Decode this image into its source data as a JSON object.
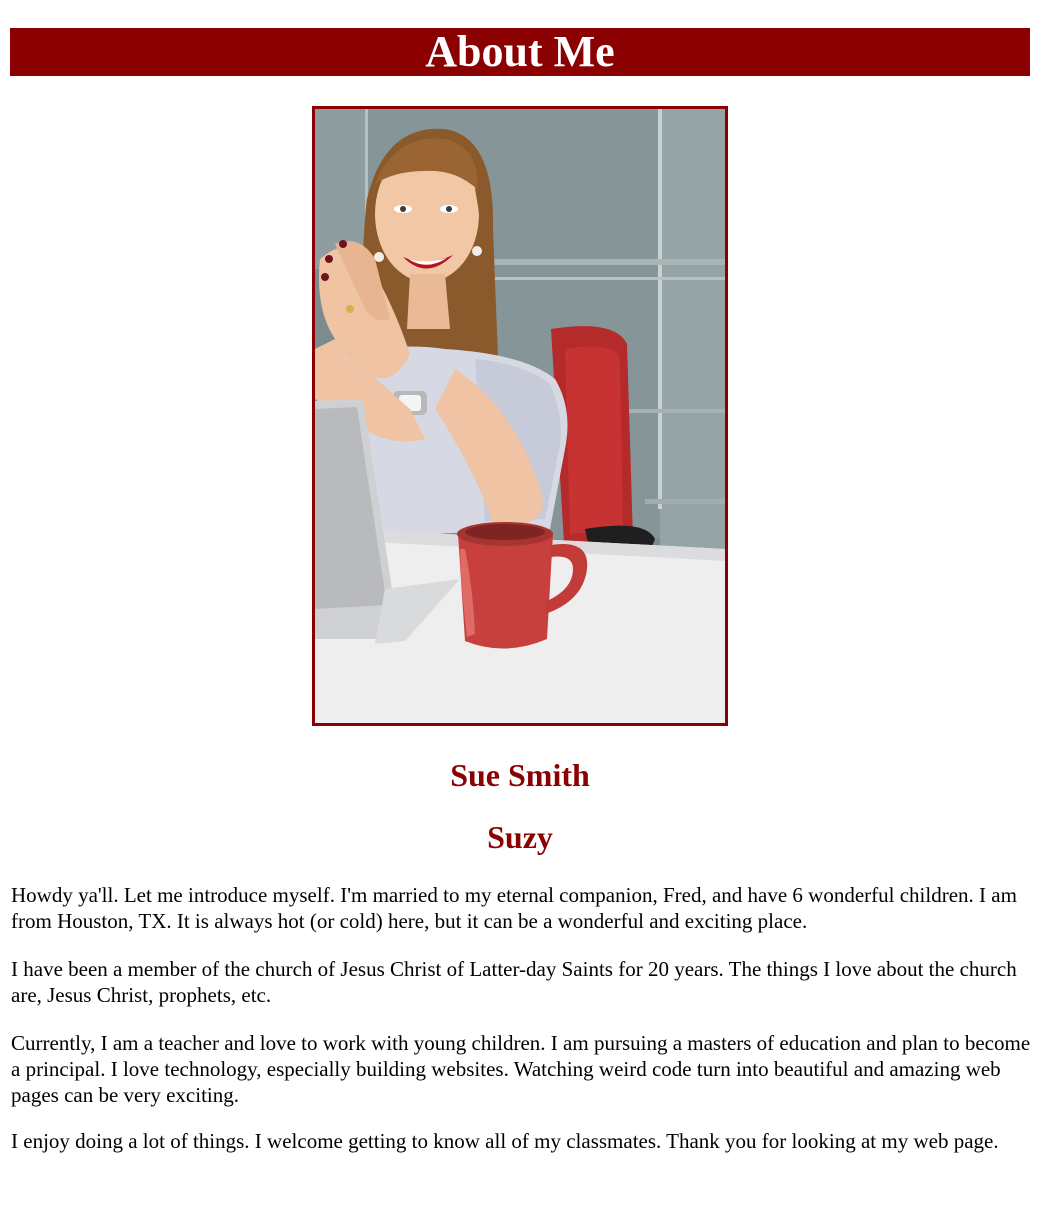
{
  "header": {
    "title": "About Me"
  },
  "profile": {
    "full_name": "Sue Smith",
    "nickname": "Suzy"
  },
  "bio": {
    "paragraphs": [
      "Howdy ya'll. Let me introduce myself. I'm married to my eternal companion, Fred, and have 6 wonderful children. I am from Houston, TX. It is always hot (or cold) here, but it can be a wonderful and exciting place.",
      "I have been a member of the church of Jesus Christ of Latter-day Saints for 20 years. The things I love about the church are, Jesus Christ, prophets, etc.",
      "Currently, I am a teacher and love to work with young children. I am pursuing a masters of education and plan to become a principal. I love technology, especially building websites. Watching weird code turn into beautiful and amazing web pages can be very exciting.",
      "I enjoy doing a lot of things. I welcome getting to know all of my classmates. Thank you for looking at my web page."
    ]
  },
  "theme": {
    "accent": "#8b0000",
    "banner_text": "#ffffff"
  }
}
